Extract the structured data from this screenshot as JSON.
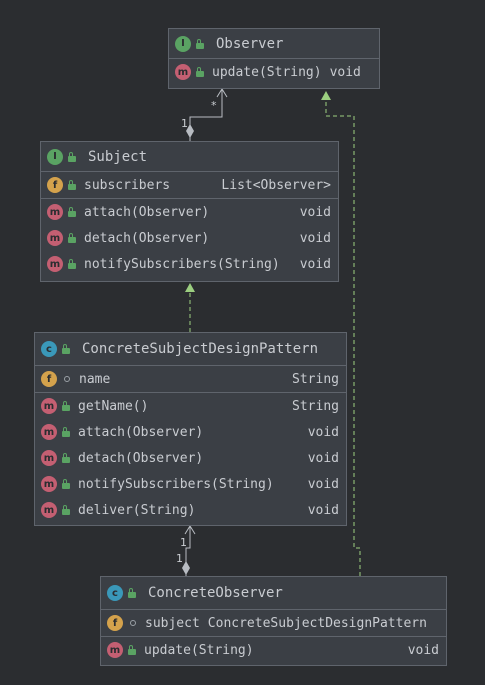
{
  "colors": {
    "background": "#2b2d30",
    "box": "#3b3f45",
    "border": "#5f646c",
    "interface_icon": "#5aa363",
    "class_icon": "#3a98b9",
    "method_icon": "#c45f72",
    "field_icon": "#d4a24c",
    "inheritance_arrow": "#9ccf80"
  },
  "observer": {
    "icon": "I",
    "title": "Observer",
    "methods": [
      {
        "icon": "m",
        "name": "update(String)",
        "type": "void"
      }
    ]
  },
  "subject": {
    "icon": "I",
    "title": "Subject",
    "fields": [
      {
        "icon": "f",
        "name": "subscribers",
        "type": "List<Observer>"
      }
    ],
    "methods": [
      {
        "icon": "m",
        "name": "attach(Observer)",
        "type": "void"
      },
      {
        "icon": "m",
        "name": "detach(Observer)",
        "type": "void"
      },
      {
        "icon": "m",
        "name": "notifySubscribers(String)",
        "type": "void"
      }
    ]
  },
  "concrete_subject": {
    "icon": "c",
    "title": "ConcreteSubjectDesignPattern",
    "fields": [
      {
        "icon": "f",
        "name": "name",
        "type": "String"
      }
    ],
    "methods": [
      {
        "icon": "m",
        "name": "getName()",
        "type": "String"
      },
      {
        "icon": "m",
        "name": "attach(Observer)",
        "type": "void"
      },
      {
        "icon": "m",
        "name": "detach(Observer)",
        "type": "void"
      },
      {
        "icon": "m",
        "name": "notifySubscribers(String)",
        "type": "void"
      },
      {
        "icon": "m",
        "name": "deliver(String)",
        "type": "void"
      }
    ]
  },
  "concrete_observer": {
    "icon": "c",
    "title": "ConcreteObserver",
    "fields": [
      {
        "icon": "f",
        "name": "subject",
        "type": "ConcreteSubjectDesignPattern"
      }
    ],
    "methods": [
      {
        "icon": "m",
        "name": "update(String)",
        "type": "void"
      }
    ]
  },
  "labels": {
    "subject_observer_source": "1",
    "subject_observer_target": "*",
    "co_target": "1",
    "co_source": "1"
  }
}
